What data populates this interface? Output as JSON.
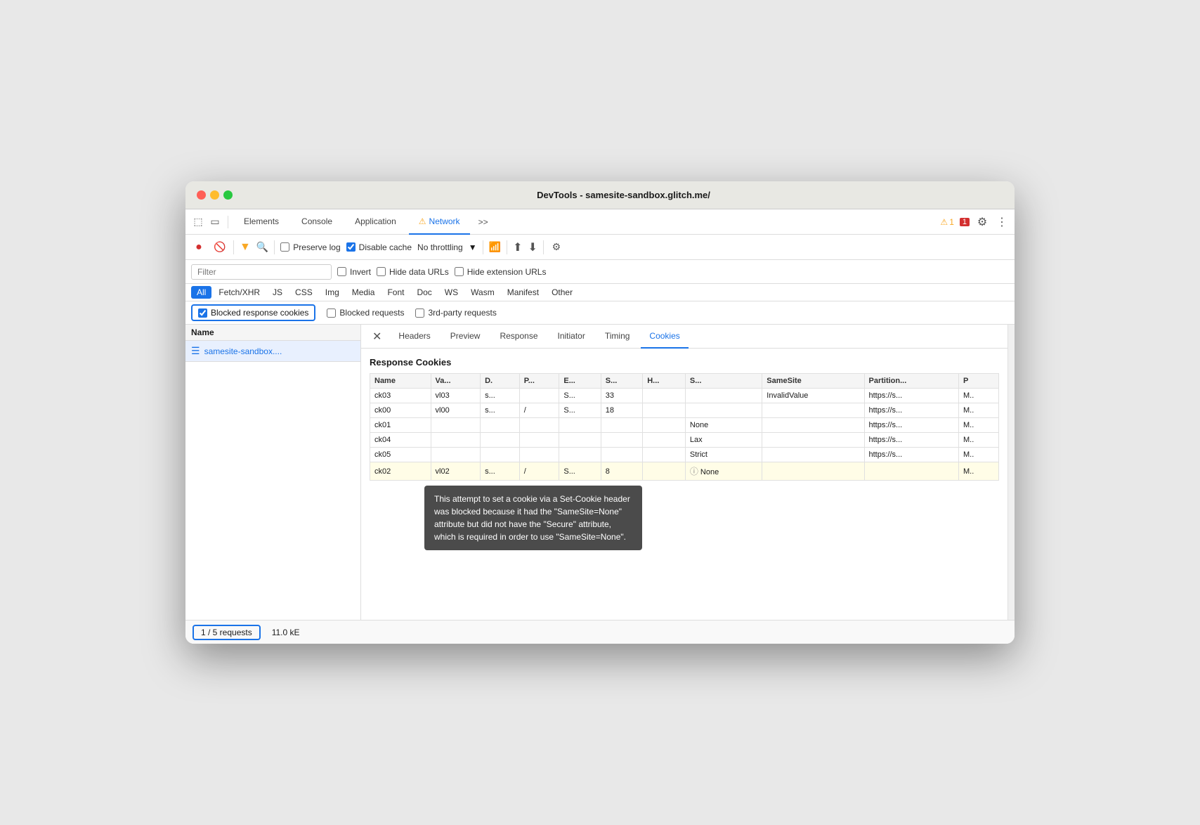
{
  "window": {
    "title": "DevTools - samesite-sandbox.glitch.me/"
  },
  "tabs": {
    "items": [
      {
        "label": "Elements",
        "active": false
      },
      {
        "label": "Console",
        "active": false
      },
      {
        "label": "Application",
        "active": false
      },
      {
        "label": "Network",
        "active": true,
        "warning": true
      },
      {
        "label": ">>",
        "active": false
      }
    ]
  },
  "toolbar": {
    "preserve_log_label": "Preserve log",
    "disable_cache_label": "Disable cache",
    "throttle_label": "No throttling",
    "filter_placeholder": "Filter",
    "invert_label": "Invert",
    "hide_data_urls_label": "Hide data URLs",
    "hide_ext_label": "Hide extension URLs"
  },
  "type_filters": [
    "All",
    "Fetch/XHR",
    "JS",
    "CSS",
    "Img",
    "Media",
    "Font",
    "Doc",
    "WS",
    "Wasm",
    "Manifest",
    "Other"
  ],
  "cookie_filters": {
    "blocked_response_label": "Blocked response cookies",
    "blocked_requests_label": "Blocked requests",
    "third_party_label": "3rd-party requests"
  },
  "badges": {
    "warning_count": "1",
    "error_count": "1"
  },
  "left_panel": {
    "col_header": "Name",
    "request_name": "samesite-sandbox...."
  },
  "detail_tabs": [
    "Headers",
    "Preview",
    "Response",
    "Initiator",
    "Timing",
    "Cookies"
  ],
  "cookies_panel": {
    "section_title": "Response Cookies",
    "columns": [
      "Name",
      "Va...",
      "D.",
      "P...",
      "E...",
      "S...",
      "H...",
      "S...",
      "SameSite",
      "Partition...",
      "P"
    ],
    "rows": [
      {
        "name": "ck03",
        "va": "vl03",
        "d": "s...",
        "p": "",
        "e": "S...",
        "s": "33",
        "h": "",
        "sx": "",
        "samesite": "InvalidValue",
        "partition": "https://s...",
        "p2": "M..",
        "highlight": false
      },
      {
        "name": "ck00",
        "va": "vl00",
        "d": "s...",
        "p": "/",
        "e": "S...",
        "s": "18",
        "h": "",
        "sx": "",
        "samesite": "",
        "partition": "https://s...",
        "p2": "M..",
        "highlight": false
      },
      {
        "name": "ck01",
        "va": "",
        "d": "",
        "p": "",
        "e": "",
        "s": "",
        "h": "",
        "sx": "None",
        "samesite": "",
        "partition": "https://s...",
        "p2": "M..",
        "highlight": false
      },
      {
        "name": "ck04",
        "va": "",
        "d": "",
        "p": "",
        "e": "",
        "s": "",
        "h": "",
        "sx": "Lax",
        "samesite": "",
        "partition": "https://s...",
        "p2": "M..",
        "highlight": false
      },
      {
        "name": "ck05",
        "va": "",
        "d": "",
        "p": "",
        "e": "",
        "s": "",
        "h": "",
        "sx": "Strict",
        "samesite": "",
        "partition": "https://s...",
        "p2": "M..",
        "highlight": false
      },
      {
        "name": "ck02",
        "va": "vl02",
        "d": "s...",
        "p": "/",
        "e": "S...",
        "s": "8",
        "h": "",
        "sx": "ⓘ None",
        "samesite": "",
        "partition": "",
        "p2": "M..",
        "highlight": true
      }
    ]
  },
  "tooltip": {
    "text": "This attempt to set a cookie via a Set-Cookie header was blocked because it had the \"SameSite=None\" attribute but did not have the \"Secure\" attribute, which is required in order to use \"SameSite=None\"."
  },
  "statusbar": {
    "requests_label": "1 / 5 requests",
    "size_label": "11.0 kE"
  }
}
